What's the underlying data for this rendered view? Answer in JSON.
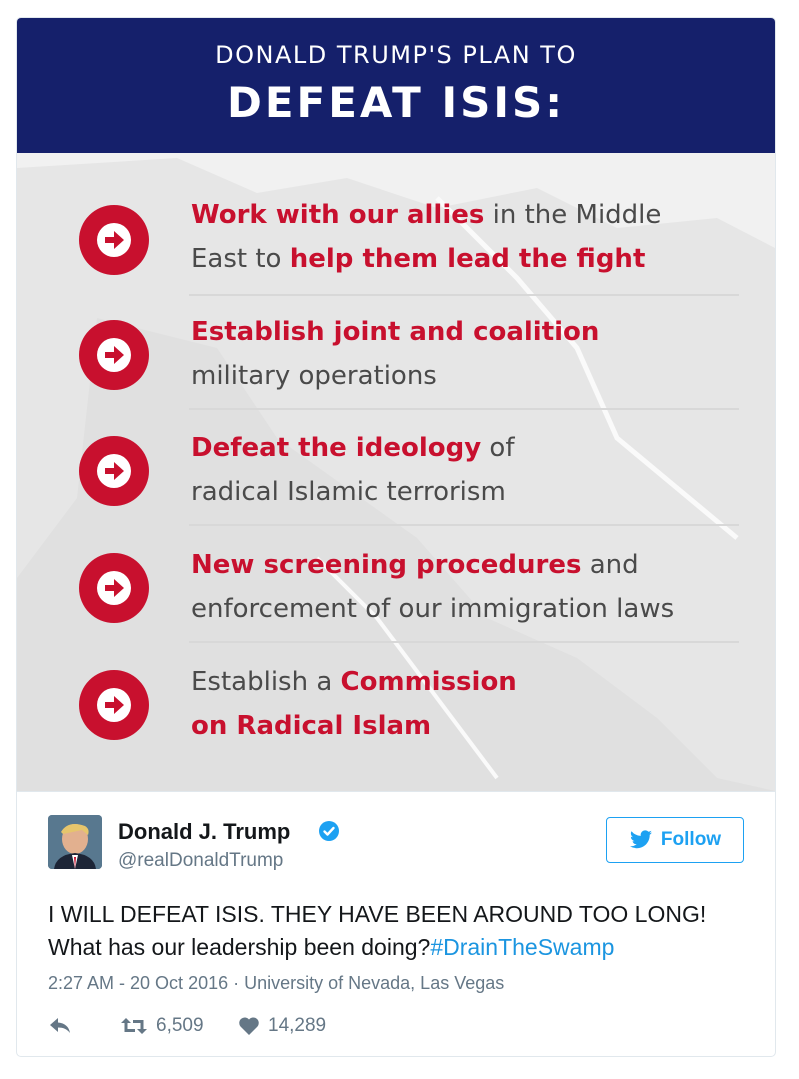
{
  "graphic": {
    "subtitle": "DONALD TRUMP'S PLAN TO",
    "title": "DEFEAT ISIS:",
    "items": [
      {
        "line1": [
          {
            "t": "Work with our allies",
            "h": true
          },
          {
            "t": " in the Middle",
            "h": false
          }
        ],
        "line2": [
          {
            "t": "East to ",
            "h": false
          },
          {
            "t": "help them lead the fight",
            "h": true
          }
        ]
      },
      {
        "line1": [
          {
            "t": "Establish joint and coalition",
            "h": true
          }
        ],
        "line2": [
          {
            "t": "military operations",
            "h": false
          }
        ]
      },
      {
        "line1": [
          {
            "t": "Defeat the ideology",
            "h": true
          },
          {
            "t": " of",
            "h": false
          }
        ],
        "line2": [
          {
            "t": "radical Islamic terrorism",
            "h": false
          }
        ]
      },
      {
        "line1": [
          {
            "t": "New screening procedures",
            "h": true
          },
          {
            "t": " and",
            "h": false
          }
        ],
        "line2": [
          {
            "t": "enforcement of our immigration laws",
            "h": false
          }
        ]
      },
      {
        "line1": [
          {
            "t": "Establish a ",
            "h": false
          },
          {
            "t": "Commission",
            "h": true
          }
        ],
        "line2": [
          {
            "t": "on Radical Islam",
            "h": true
          }
        ]
      }
    ],
    "colors": {
      "banner": "#15206b",
      "accent": "#c8102e"
    },
    "icon": "arrow-right-circle-icon"
  },
  "tweet": {
    "name": "Donald J. Trump",
    "handle": "@realDonaldTrump",
    "follow_label": "Follow",
    "text": "I WILL DEFEAT ISIS. THEY HAVE BEEN AROUND TOO LONG! What has our leadership been doing?",
    "hashtag": "#DrainTheSwamp",
    "timestamp": "2:27 AM - 20 Oct 2016",
    "separator": " · ",
    "location": "University of Nevada, Las Vegas",
    "retweets": "6,509",
    "likes": "14,289",
    "colors": {
      "link": "#1b95e0",
      "follow": "#1da1f2",
      "muted": "#657786"
    }
  }
}
